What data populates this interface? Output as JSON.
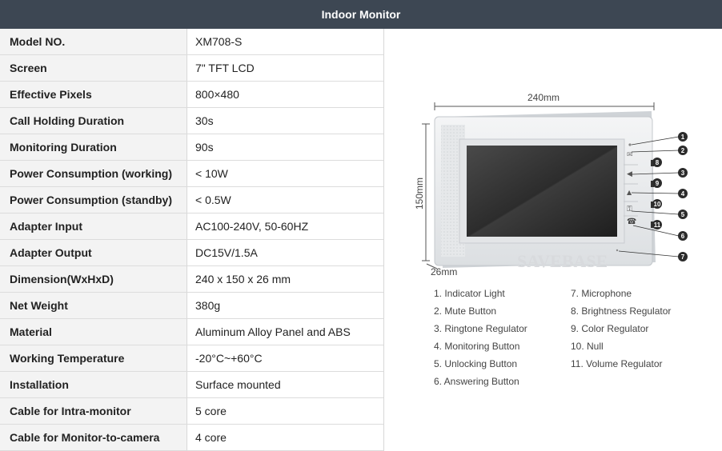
{
  "header": {
    "title": "Indoor Monitor"
  },
  "specs": [
    {
      "label": "Model NO.",
      "value": "XM708-S"
    },
    {
      "label": "Screen",
      "value": "7\" TFT LCD"
    },
    {
      "label": "Effective Pixels",
      "value": "800×480"
    },
    {
      "label": "Call Holding Duration",
      "value": "30s"
    },
    {
      "label": "Monitoring Duration",
      "value": "90s"
    },
    {
      "label": "Power Consumption (working)",
      "value": "< 10W"
    },
    {
      "label": "Power Consumption (standby)",
      "value": "< 0.5W"
    },
    {
      "label": "Adapter Input",
      "value": "AC100-240V, 50-60HZ"
    },
    {
      "label": "Adapter Output",
      "value": "DC15V/1.5A"
    },
    {
      "label": "Dimension(WxHxD)",
      "value": "240 x 150 x 26 mm"
    },
    {
      "label": "Net Weight",
      "value": "380g"
    },
    {
      "label": "Material",
      "value": "Aluminum Alloy Panel and ABS"
    },
    {
      "label": "Working Temperature",
      "value": "-20°C~+60°C"
    },
    {
      "label": "Installation",
      "value": "Surface mounted"
    },
    {
      "label": "Cable for Intra-monitor",
      "value": "5 core"
    },
    {
      "label": "Cable for Monitor-to-camera",
      "value": "4 core"
    }
  ],
  "diagram": {
    "width_label": "240mm",
    "height_label": "150mm",
    "depth_label": "26mm",
    "watermark": "SAVEBASE",
    "callout_numbers": [
      "1",
      "2",
      "8",
      "3",
      "9",
      "4",
      "10",
      "5",
      "11",
      "6",
      "7"
    ],
    "legend": [
      "1. Indicator Light",
      "2. Mute Button",
      "3. Ringtone Regulator",
      "4. Monitoring Button",
      "5. Unlocking Button",
      "6. Answering Button",
      "7. Microphone",
      "8. Brightness Regulator",
      "9. Color Regulator",
      "10. Null",
      "11. Volume Regulator"
    ]
  }
}
